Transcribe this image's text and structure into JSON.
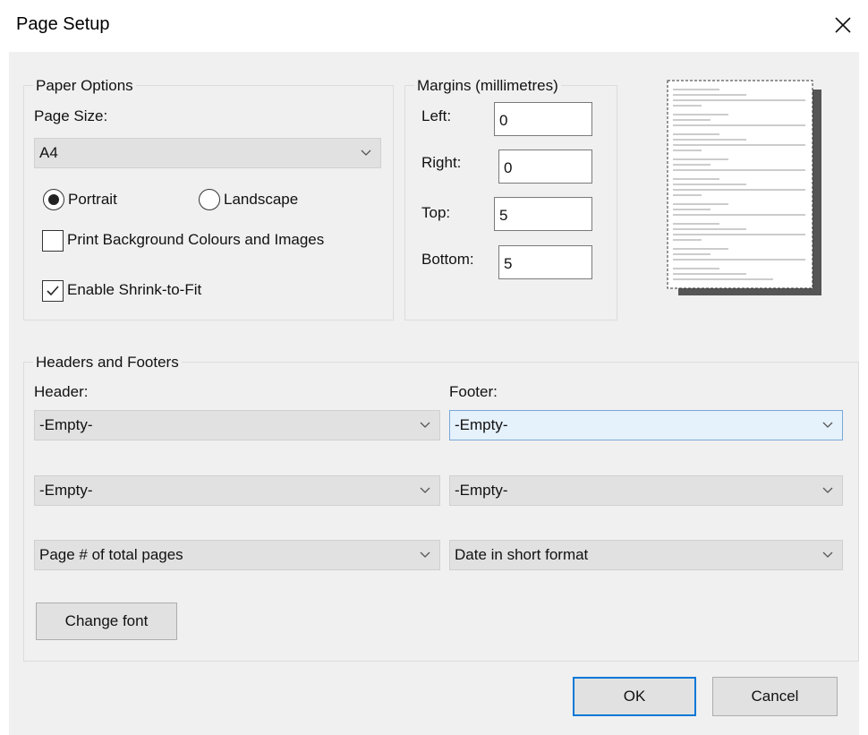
{
  "window": {
    "title": "Page Setup"
  },
  "paper_options": {
    "legend": "Paper Options",
    "page_size_label": "Page Size:",
    "page_size_value": "A4",
    "orientation": {
      "portrait_label": "Portrait",
      "landscape_label": "Landscape",
      "selected": "Portrait"
    },
    "print_background_label": "Print Background Colours and Images",
    "print_background_checked": false,
    "shrink_to_fit_label": "Enable Shrink-to-Fit",
    "shrink_to_fit_checked": true
  },
  "margins": {
    "legend": "Margins (millimetres)",
    "left_label": "Left:",
    "left_value": "0",
    "right_label": "Right:",
    "right_value": "0",
    "top_label": "Top:",
    "top_value": "5",
    "bottom_label": "Bottom:",
    "bottom_value": "5"
  },
  "headers_footers": {
    "legend": "Headers and Footers",
    "header_label": "Header:",
    "footer_label": "Footer:",
    "header_values": [
      "-Empty-",
      "-Empty-",
      "Page # of total pages"
    ],
    "footer_values": [
      "-Empty-",
      "-Empty-",
      "Date in short format"
    ],
    "change_font_label": "Change font"
  },
  "buttons": {
    "ok_label": "OK",
    "cancel_label": "Cancel"
  },
  "icons": {
    "close": "close-icon",
    "dropdown": "chevron-down-icon",
    "check": "checkmark-icon",
    "preview": "page-preview-icon"
  },
  "colors": {
    "dialog_bg": "#f0f0f0",
    "accent": "#0078d7",
    "combo_bg": "#e1e1e1",
    "focus_bg": "#e5f1fb"
  }
}
